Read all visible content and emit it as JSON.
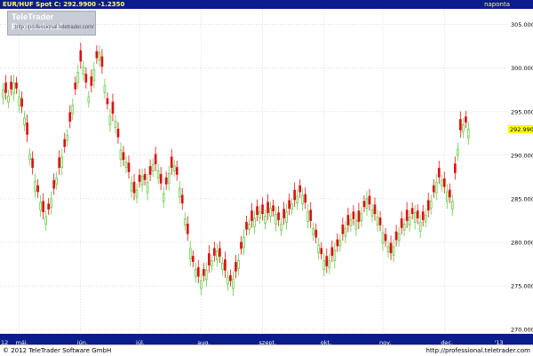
{
  "header": {
    "instrument": "EUR/HUF Spot",
    "close_label": "C:",
    "close_value": "292.9900",
    "change": "-1.2350",
    "period": "naponta"
  },
  "watermark": {
    "title": "TeleTrader Professional",
    "url": "http://professional.teletrader.com/"
  },
  "footer": {
    "copyright": "© 2012 TeleTrader Software GmbH",
    "url": "http://professional.teletrader.com"
  },
  "colors": {
    "up": "#66cc44",
    "down": "#dd1111",
    "header_bg": "#0b1d8c",
    "grid": "#c8c8c8",
    "price_tag": "#ffff00"
  },
  "chart_data": {
    "type": "candlestick",
    "y_ticks": [
      "270.0000",
      "275.0000",
      "280.0000",
      "285.0000",
      "290.0000",
      "295.0000",
      "300.0000",
      "305.0000"
    ],
    "ylim": [
      269.5,
      306.8
    ],
    "last_price": 292.99,
    "last_price_label": "292.9900",
    "x_labels": [
      "12",
      "máj.",
      "jún.",
      "júl.",
      "aug.",
      "szept.",
      "okt.",
      "nov.",
      "dec.",
      "'13"
    ],
    "x_label_index": [
      0,
      6,
      29,
      51,
      74,
      97,
      120,
      142,
      165,
      185
    ],
    "n_sessions": 188,
    "grid": true,
    "close": [
      297.5,
      297.2,
      296.8,
      297.6,
      298.3,
      297.7,
      296.7,
      295.6,
      294.3,
      292.4,
      290.1,
      288.6,
      287.0,
      285.8,
      284.6,
      283.5,
      282.9,
      283.8,
      285.0,
      286.2,
      287.4,
      288.6,
      289.8,
      291.0,
      292.3,
      293.9,
      295.7,
      297.6,
      299.5,
      300.8,
      300.1,
      298.4,
      296.7,
      298.0,
      299.8,
      301.2,
      301.8,
      300.2,
      298.0,
      295.9,
      294.5,
      294.8,
      293.9,
      292.1,
      290.6,
      289.5,
      289.2,
      288.1,
      286.8,
      285.7,
      286.0,
      287.0,
      287.6,
      287.2,
      286.9,
      287.8,
      288.9,
      289.0,
      288.2,
      286.8,
      285.6,
      286.7,
      287.9,
      288.6,
      288.8,
      287.8,
      286.2,
      284.5,
      282.7,
      281.0,
      279.3,
      277.8,
      276.9,
      276.1,
      275.6,
      276.2,
      276.8,
      277.4,
      277.9,
      278.5,
      279.0,
      278.4,
      277.6,
      276.8,
      276.0,
      275.6,
      275.8,
      276.7,
      277.9,
      279.3,
      280.6,
      281.5,
      282.1,
      282.5,
      282.8,
      283.2,
      283.5,
      283.3,
      283.0,
      283.4,
      283.9,
      283.6,
      283.2,
      282.6,
      282.1,
      282.8,
      283.5,
      283.9,
      284.4,
      284.9,
      285.3,
      285.8,
      285.4,
      284.6,
      283.5,
      282.5,
      281.6,
      280.6,
      279.7,
      278.7,
      277.9,
      277.3,
      277.9,
      278.5,
      279.1,
      279.6,
      280.2,
      281.0,
      281.6,
      282.0,
      282.6,
      282.7,
      282.5,
      282.4,
      283.3,
      284.1,
      285.0,
      284.4,
      283.7,
      283.3,
      282.9,
      282.0,
      281.1,
      280.2,
      279.5,
      278.8,
      279.5,
      280.3,
      281.0,
      281.7,
      282.1,
      282.5,
      282.9,
      283.3,
      283.4,
      282.8,
      282.3,
      282.6,
      283.1,
      283.7,
      284.7,
      285.8,
      286.9,
      287.5,
      287.1,
      286.4,
      285.8,
      285.2,
      284.7,
      288.0,
      290.7,
      292.9,
      293.5,
      293.8,
      293.0
    ],
    "open_offsets": [
      -0.9,
      1.1,
      -0.7,
      0.8,
      -1.2,
      0.6,
      -1.0,
      0.9,
      -0.8,
      1.3,
      -0.6,
      1.0,
      -1.1,
      0.7,
      -0.9,
      1.2,
      -0.8,
      0.6,
      -1.0,
      0.9,
      -0.7,
      1.1,
      -1.2,
      0.8,
      -0.6,
      1.0,
      -0.9,
      0.7,
      -1.1,
      1.2,
      -0.8,
      0.9,
      -0.6,
      1.0,
      -1.2,
      0.7,
      -0.9,
      1.1,
      -0.8,
      0.6,
      -1.0,
      1.3,
      -0.7,
      0.9,
      -1.1,
      0.8,
      -0.6,
      1.0,
      -0.9,
      1.2,
      -0.8,
      0.7,
      -1.0,
      0.6,
      -1.2,
      0.9,
      -0.7,
      1.1,
      -0.8,
      1.0,
      -0.9,
      0.7,
      -1.1,
      1.2,
      -0.6,
      0.8,
      -1.0,
      0.9,
      -0.7,
      1.1,
      -1.2,
      0.6,
      -0.8,
      1.0,
      -0.9,
      0.7,
      -1.1,
      1.3,
      -0.6,
      0.8,
      -1.0,
      0.9,
      -0.7,
      1.2,
      -0.8,
      0.6,
      -1.1,
      1.0,
      -0.9,
      0.7,
      -1.2,
      0.8,
      -0.6,
      1.1,
      -1.0,
      0.9,
      -0.7,
      1.0,
      -0.8,
      1.2,
      -0.9,
      0.6,
      -1.1,
      0.8,
      -0.7,
      1.0,
      -1.2,
      0.9,
      -0.6,
      1.1,
      -0.8,
      0.7,
      -1.0,
      0.9,
      -1.1,
      1.2,
      -0.7,
      0.8,
      -0.9,
      0.6,
      -1.0,
      1.1,
      -0.8,
      0.9,
      -1.2,
      0.7,
      -0.6,
      1.0,
      -0.9,
      1.1,
      -0.7,
      0.8,
      -1.0,
      1.2,
      -0.8,
      0.6,
      -1.1,
      0.9,
      -0.7,
      1.0,
      -0.9,
      0.8,
      -1.2,
      0.7,
      -0.6,
      1.1,
      -1.0,
      0.9,
      -0.8,
      1.0,
      -0.7,
      1.2,
      -0.9,
      0.6,
      -1.1,
      0.8,
      -1.0,
      0.9,
      -0.7,
      1.1,
      -0.8,
      0.7,
      -1.2,
      1.0,
      -0.6,
      0.9,
      -1.1,
      0.8,
      -0.9,
      1.0,
      -0.7,
      1.2,
      -0.8,
      0.6,
      -1.0,
      0.9,
      -1.1,
      0.7,
      -0.6,
      1.1,
      -0.9,
      0.8
    ]
  }
}
